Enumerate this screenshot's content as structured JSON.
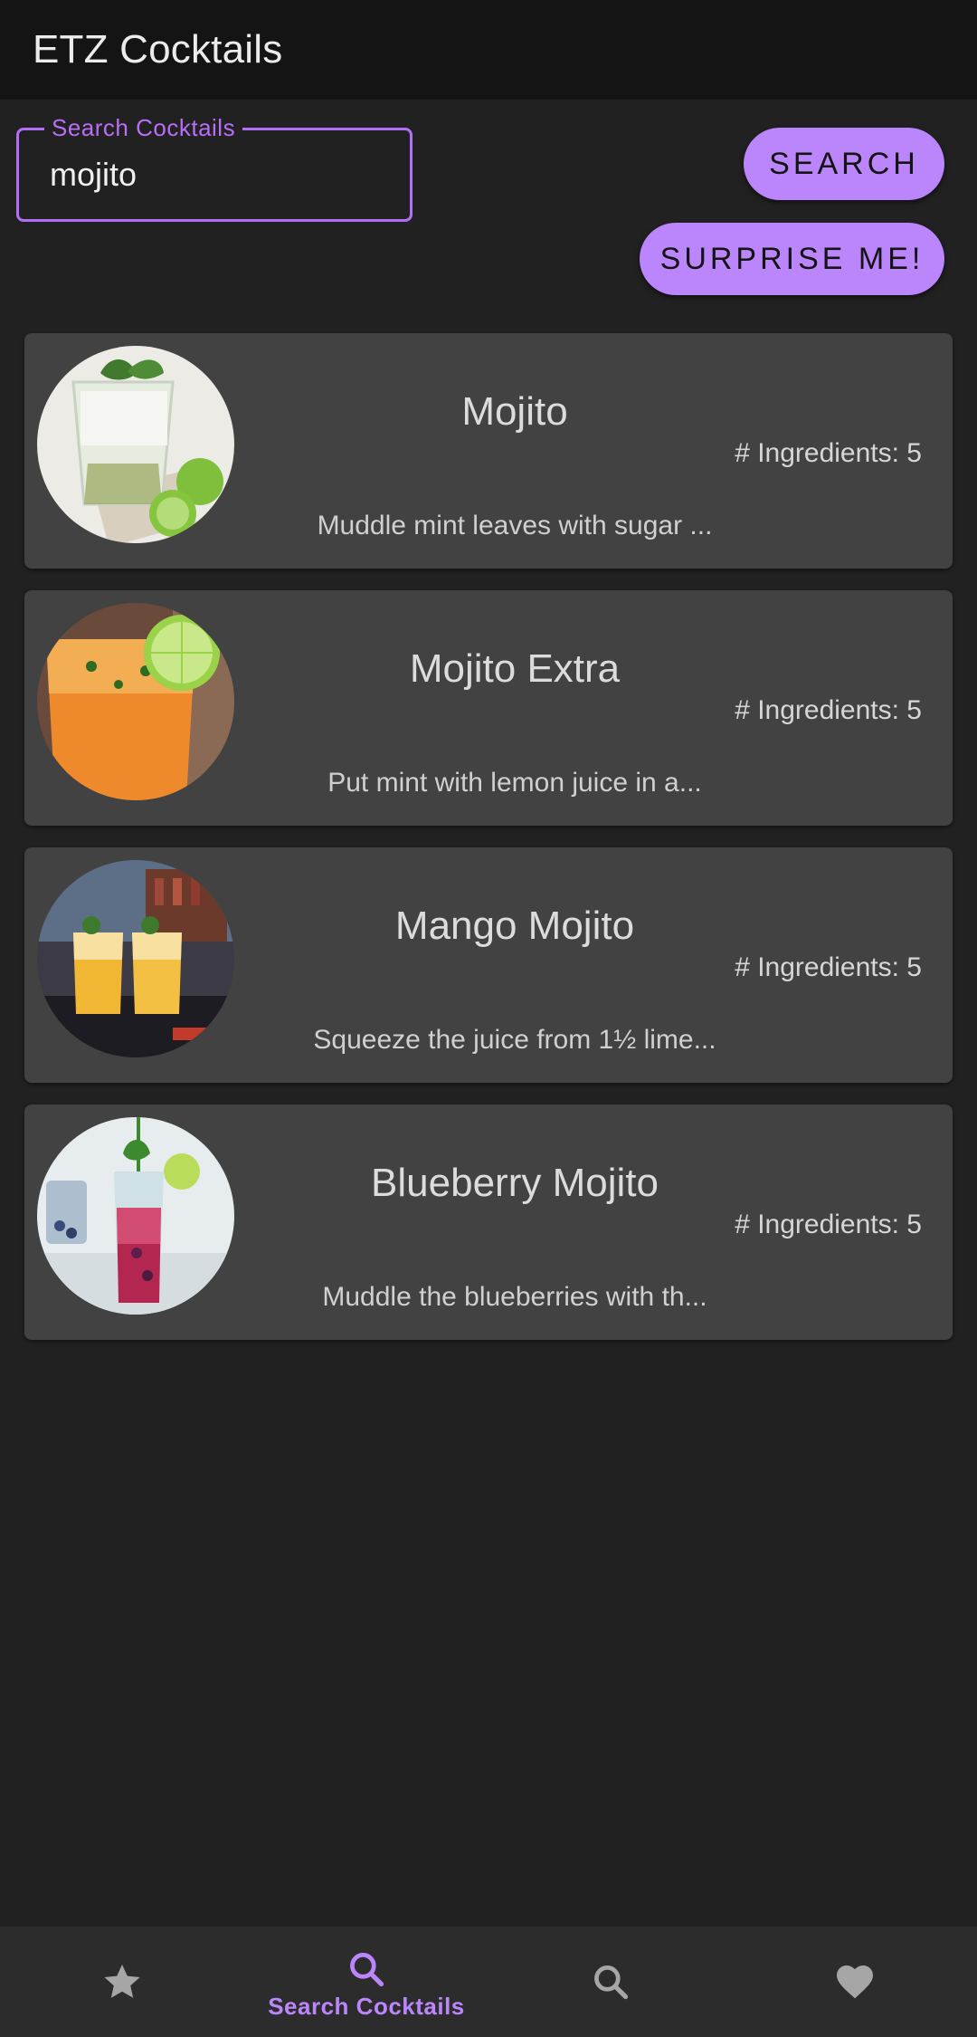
{
  "app": {
    "title": "ETZ Cocktails"
  },
  "search": {
    "label": "Search Cocktails",
    "value": "mojito",
    "search_button": "SEARCH",
    "surprise_button": "SURPRISE ME!"
  },
  "cocktails": [
    {
      "name": "Mojito",
      "ingredients": "# Ingredients: 5",
      "description": "Muddle mint leaves with sugar ..."
    },
    {
      "name": "Mojito Extra",
      "ingredients": "# Ingredients: 5",
      "description": "Put mint with lemon juice in a..."
    },
    {
      "name": "Mango Mojito",
      "ingredients": "# Ingredients: 5",
      "description": "Squeeze the juice from 1½ lime..."
    },
    {
      "name": "Blueberry Mojito",
      "ingredients": "# Ingredients: 5",
      "description": "Muddle the blueberries with th..."
    }
  ],
  "bottom_nav": {
    "items": [
      {
        "icon": "star-icon",
        "label": "",
        "active": false
      },
      {
        "icon": "search-icon",
        "label": "Search Cocktails",
        "active": true
      },
      {
        "icon": "search-icon",
        "label": "",
        "active": false
      },
      {
        "icon": "heart-icon",
        "label": "",
        "active": false
      }
    ]
  },
  "colors": {
    "accent": "#bb86fc",
    "background": "#212121",
    "appbar": "#141414",
    "card": "#424242",
    "nav_inactive": "#a6a6a6"
  }
}
